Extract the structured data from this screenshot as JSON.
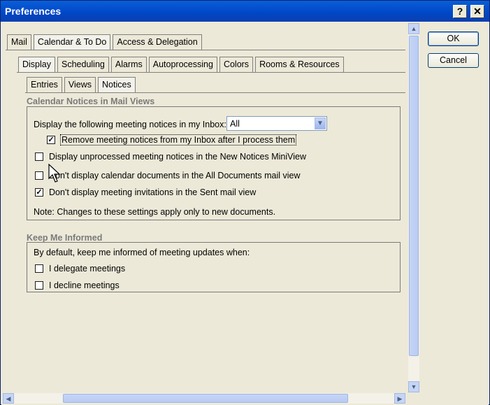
{
  "window": {
    "title": "Preferences",
    "help_label": "?",
    "close_label": "✕"
  },
  "tabs_main": [
    "Mail",
    "Calendar & To Do",
    "Access & Delegation"
  ],
  "tabs_sub": [
    "Display",
    "Scheduling",
    "Alarms",
    "Autoprocessing",
    "Colors",
    "Rooms & Resources"
  ],
  "tabs_inner": [
    "Entries",
    "Views",
    "Notices"
  ],
  "notices": {
    "group_title": "Calendar Notices in Mail Views",
    "inbox_label": "Display the following meeting notices in my Inbox:",
    "inbox_select_value": "All",
    "options": [
      {
        "label": "Remove meeting notices from my Inbox after I process them",
        "checked": true
      },
      {
        "label": "Display unprocessed meeting notices in the New Notices MiniView",
        "checked": false
      },
      {
        "label": "Don't display calendar documents in the All Documents mail view",
        "checked": false
      },
      {
        "label": "Don't display meeting invitations in the Sent mail view",
        "checked": true
      }
    ],
    "note": "Note:  Changes to these settings apply only to new documents."
  },
  "keep_informed": {
    "group_title": "Keep Me Informed",
    "intro": "By default, keep me informed of meeting updates when:",
    "options": [
      {
        "label": "I delegate meetings",
        "checked": false
      },
      {
        "label": "I decline meetings",
        "checked": false
      }
    ]
  },
  "buttons": {
    "ok": "OK",
    "cancel": "Cancel"
  },
  "check_glyph": "✓",
  "icons": {
    "scroll_up": "▲",
    "scroll_down": "▼",
    "scroll_left": "◀",
    "scroll_right": "▶",
    "dropdown": "▼"
  }
}
